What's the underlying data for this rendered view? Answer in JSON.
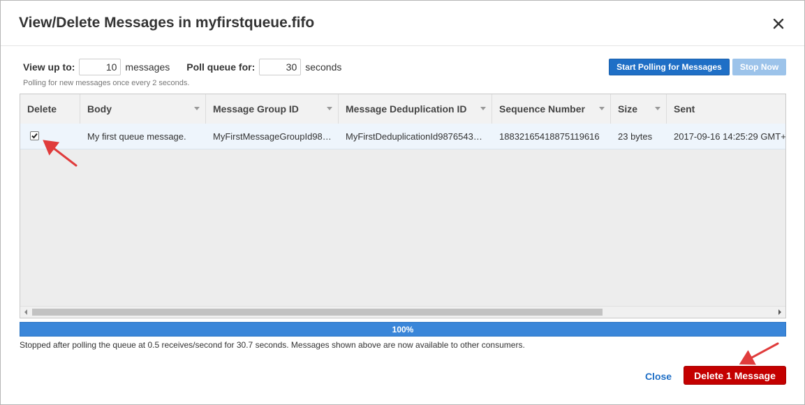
{
  "dialog": {
    "title": "View/Delete Messages in myfirstqueue.fifo",
    "close_glyph": "×"
  },
  "controls": {
    "view_up_to_label": "View up to:",
    "view_up_to_value": "10",
    "messages_unit": "messages",
    "poll_label": "Poll queue for:",
    "poll_value": "30",
    "seconds_unit": "seconds",
    "hint": "Polling for new messages once every 2 seconds.",
    "start_button": "Start Polling for Messages",
    "stop_button": "Stop Now"
  },
  "table": {
    "columns": [
      "Delete",
      "Body",
      "Message Group ID",
      "Message Deduplication ID",
      "Sequence Number",
      "Size",
      "Sent"
    ],
    "rows": [
      {
        "delete_checked": true,
        "body": "My first queue message.",
        "group_id": "MyFirstMessageGroupId98…",
        "dedup_id": "MyFirstDeduplicationId9876543…",
        "sequence_number": "18832165418875119616",
        "size": "23 bytes",
        "sent": "2017-09-16 14:25:29 GMT+"
      }
    ]
  },
  "progress": {
    "percent": 100,
    "label": "100%"
  },
  "status_text": "Stopped after polling the queue at 0.5 receives/second for 30.7 seconds. Messages shown above are now available to other consumers.",
  "footer": {
    "close_button": "Close",
    "delete_button": "Delete 1 Message"
  },
  "colors": {
    "primary_blue": "#1f6fc6",
    "disabled_blue": "#9cc3ea",
    "progress_blue": "#3a86d9",
    "delete_red": "#c40000",
    "annotation_arrow": "#e03c3c"
  },
  "icons": {
    "close": "close-icon",
    "sort": "sort-caret-icon",
    "checkbox": "checkbox-checked-icon",
    "scroll_left": "scroll-left-arrow-icon",
    "scroll_right": "scroll-right-arrow-icon"
  }
}
